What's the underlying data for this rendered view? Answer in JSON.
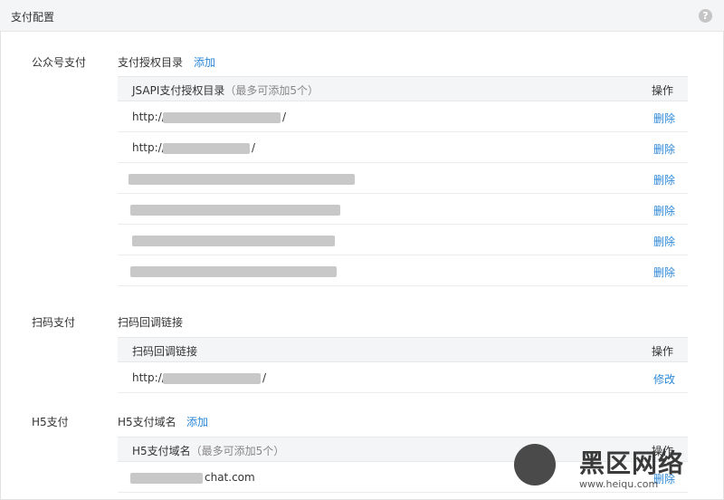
{
  "header": {
    "title": "支付配置",
    "help_glyph": "?"
  },
  "jsapi": {
    "label": "公众号支付",
    "subtitle": "支付授权目录",
    "add": "添加",
    "table": {
      "col_name": "JSAPI支付授权目录",
      "col_note": "（最多可添加5个）",
      "col_action": "操作",
      "rows": [
        {
          "url": "http://",
          "tail": "/",
          "action": "删除"
        },
        {
          "url": "http://",
          "tail": "/",
          "action": "删除"
        },
        {
          "url": "",
          "tail": "",
          "action": "删除"
        },
        {
          "url": "",
          "tail": "",
          "action": "删除"
        },
        {
          "url": "",
          "tail": "",
          "action": "删除"
        },
        {
          "url": "",
          "tail": "",
          "action": "删除"
        }
      ]
    }
  },
  "scan": {
    "label": "扫码支付",
    "subtitle": "扫码回调链接",
    "table": {
      "col_name": "扫码回调链接",
      "col_action": "操作",
      "rows": [
        {
          "url": "http://",
          "tail": "/",
          "action": "修改"
        }
      ]
    }
  },
  "h5": {
    "label": "H5支付",
    "subtitle": "H5支付域名",
    "add": "添加",
    "table": {
      "col_name": "H5支付域名",
      "col_note": "（最多可添加5个）",
      "col_action": "操作",
      "rows": [
        {
          "url": "",
          "tail": "chat.com",
          "action": "删除"
        }
      ]
    }
  },
  "watermark": {
    "text": "黑区网络",
    "site": "www.heiqu.com"
  }
}
